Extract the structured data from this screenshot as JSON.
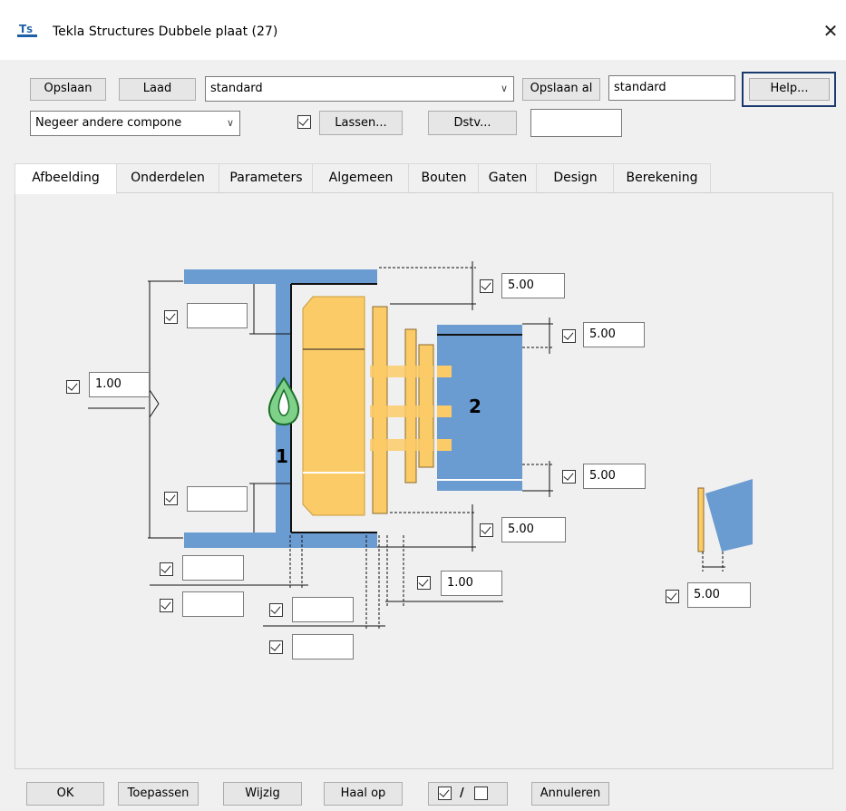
{
  "window": {
    "title": "Tekla Structures  Dubbele plaat (27)",
    "close_glyph": "✕"
  },
  "toolbar": {
    "save_label": "Opslaan",
    "load_label": "Laad",
    "attribute_set": "standard",
    "save_as_label": "Opslaan al",
    "save_as_name": "standard",
    "help_label": "Help...",
    "other_components": "Negeer andere compone",
    "welds_label": "Lassen...",
    "dstv_label": "Dstv...",
    "dstv_value": "",
    "welds_checked": true
  },
  "tabs": [
    "Afbeelding",
    "Onderdelen",
    "Parameters",
    "Algemeen",
    "Bouten",
    "Gaten",
    "Design",
    "Berekening"
  ],
  "picture": {
    "part1_label": "1",
    "part2_label": "2",
    "fields": {
      "top_right_gap": "5.00",
      "beam_top_gap": "5.00",
      "beam_bottom_gap": "5.00",
      "bottom_right_gap": "5.00",
      "left_mid": "1.00",
      "bottom_mid": "1.00",
      "skew_gap": "5.00",
      "left_top": "",
      "left_bottom": "",
      "bottom_a": "",
      "bottom_b": "",
      "bottom_c": "",
      "bottom_d": ""
    }
  },
  "footer": {
    "ok_label": "OK",
    "apply_label": "Toepassen",
    "modify_label": "Wijzig",
    "get_label": "Haal op",
    "toggle_sep": "/",
    "cancel_label": "Annuleren"
  },
  "colors": {
    "accent": "#1a3a6e",
    "steel": "#6a9bd1",
    "plate": "#fbcb68",
    "window": "#f0f0f0"
  },
  "icons": [
    "tekla-app-icon",
    "close-icon",
    "chevron-down-icon",
    "checkbox-icon",
    "weld-marker-icon"
  ]
}
